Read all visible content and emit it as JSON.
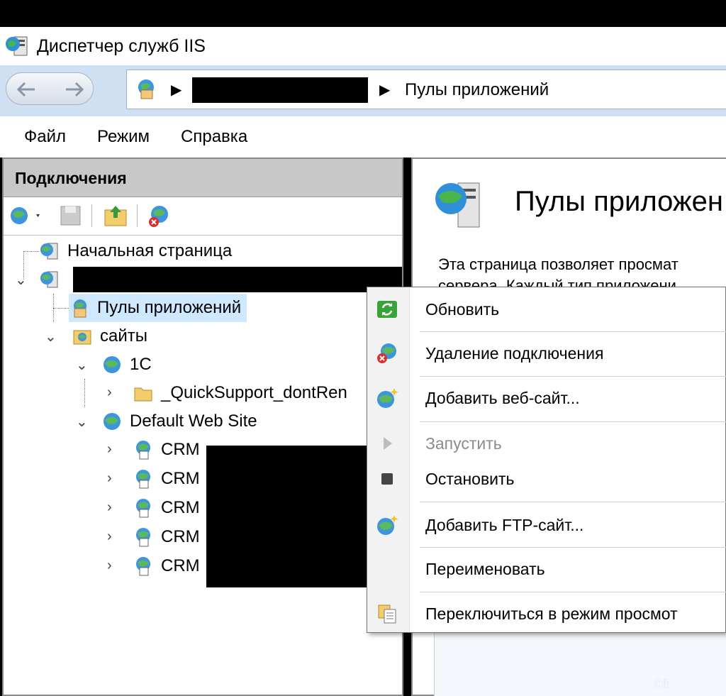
{
  "window": {
    "title": "Диспетчер служб IIS"
  },
  "address_bar": {
    "crumb": "Пулы приложений"
  },
  "menu": {
    "items": [
      "Файл",
      "Режим",
      "Справка"
    ]
  },
  "connections": {
    "header": "Подключения",
    "tree": {
      "start_page": "Начальная страница",
      "app_pools": "Пулы приложений",
      "sites": "сайты",
      "site_1c": "1С",
      "quicksupport": "_QuickSupport_dontRen",
      "default_site": "Default Web Site",
      "crm_items": [
        "CRM",
        "CRM",
        "CRM",
        "CRM",
        "CRM"
      ]
    }
  },
  "content": {
    "title": "Пулы приложен",
    "description": "Эта страница позволяет просмат",
    "description2": "сервера. Каждый тип приложени"
  },
  "context_menu": {
    "items": [
      {
        "label": "Обновить",
        "icon": "refresh-icon",
        "disabled": false
      },
      {
        "label": "Удаление подключения",
        "icon": "remove-connection-icon",
        "disabled": false
      },
      {
        "label": "Добавить веб-сайт...",
        "icon": "add-website-icon",
        "disabled": false
      },
      {
        "label": "Запустить",
        "icon": "start-icon",
        "disabled": true
      },
      {
        "label": "Остановить",
        "icon": "stop-icon",
        "disabled": false
      },
      {
        "label": "Добавить FTP-сайт...",
        "icon": "add-ftp-icon",
        "disabled": false
      },
      {
        "label": "Переименовать",
        "icon": "",
        "disabled": false
      },
      {
        "label": "Переключиться в режим просмот",
        "icon": "switch-view-icon",
        "disabled": false
      }
    ]
  },
  "watermark": "©fi",
  "colors": {
    "nav_bg": "#cfe0f3",
    "selection": "#cde8ff",
    "header_gray": "#c8c8c8"
  }
}
